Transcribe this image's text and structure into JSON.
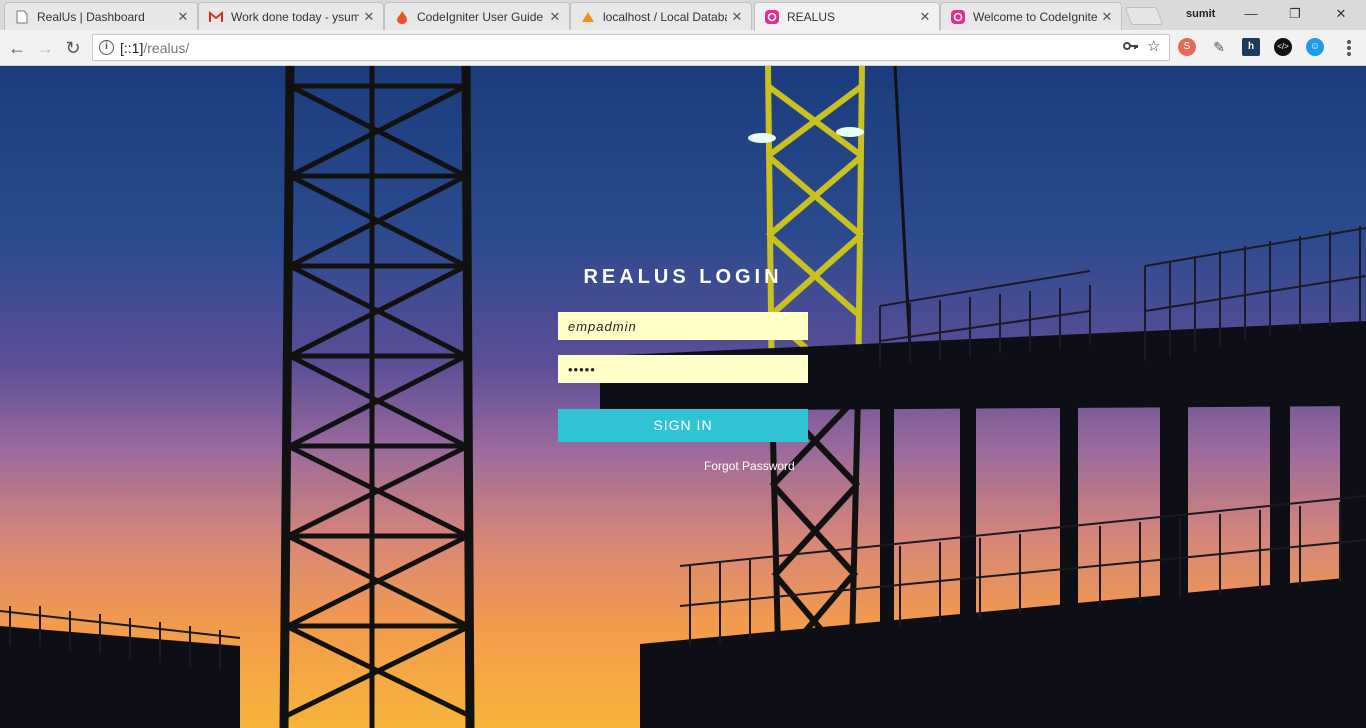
{
  "browser": {
    "tabs": [
      {
        "title": "RealUs | Dashboard",
        "icon": "document-icon"
      },
      {
        "title": "Work done today - ysum",
        "icon": "gmail-icon"
      },
      {
        "title": "CodeIgniter User Guide",
        "icon": "flame-icon"
      },
      {
        "title": "localhost / Local Databa",
        "icon": "phpmyadmin-icon"
      },
      {
        "title": "REALUS",
        "icon": "realus-icon",
        "active": true
      },
      {
        "title": "Welcome to CodeIgnite",
        "icon": "realus-icon"
      }
    ],
    "close_glyph": "✕",
    "user": "sumit",
    "window_controls": {
      "minimize": "—",
      "restore": "❐",
      "close": "✕"
    },
    "address": {
      "host": "[::1]",
      "path": "/realus/"
    },
    "nav": {
      "back": "←",
      "forward": "→",
      "reload": "↻"
    }
  },
  "login": {
    "title": "REALUS LOGIN",
    "username_value": "empadmin",
    "password_value": "•••••",
    "signin_label": "SIGN IN",
    "forgot_label": "Forgot Password"
  },
  "colors": {
    "accent_button": "#2fc3d3",
    "input_bg": "#ffffc8",
    "active_tab_favicon": "#e8298f"
  }
}
